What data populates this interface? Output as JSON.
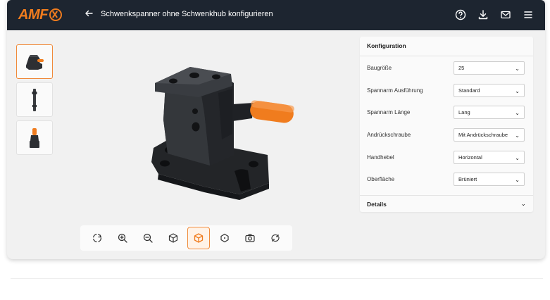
{
  "header": {
    "logo_text": "AMF",
    "title": "Schwenkspanner ohne Schwenkhub konfigurieren",
    "back_icon": "arrow-left-icon",
    "icons": [
      "help-icon",
      "download-icon",
      "mail-icon",
      "menu-icon"
    ]
  },
  "thumbnails": [
    {
      "icon": "clamp-thumbnail",
      "active": true
    },
    {
      "icon": "bolt-thumbnail",
      "active": false
    },
    {
      "icon": "clamp-side-thumbnail",
      "active": false
    }
  ],
  "toolbar": {
    "tools": [
      "rotate-icon",
      "zoom-in-icon",
      "zoom-out-icon",
      "cube-icon",
      "cube-view-icon",
      "front-view-icon",
      "camera-icon",
      "reset-view-icon"
    ],
    "active_index": 4
  },
  "config": {
    "title": "Konfiguration",
    "rows": [
      {
        "label": "Baugröße",
        "value": "25"
      },
      {
        "label": "Spannarm Ausführung",
        "value": "Standard"
      },
      {
        "label": "Spannarm Länge",
        "value": "Lang"
      },
      {
        "label": "Andrückschraube",
        "value": "Mit Andrückschraube"
      },
      {
        "label": "Handhebel",
        "value": "Horizontal"
      },
      {
        "label": "Oberfläche",
        "value": "Brüniert"
      }
    ],
    "details_label": "Details"
  },
  "colors": {
    "accent": "#f07c1e",
    "topbar": "#1d2530",
    "handle": "#f07c1e",
    "body": "#2d2f33"
  }
}
